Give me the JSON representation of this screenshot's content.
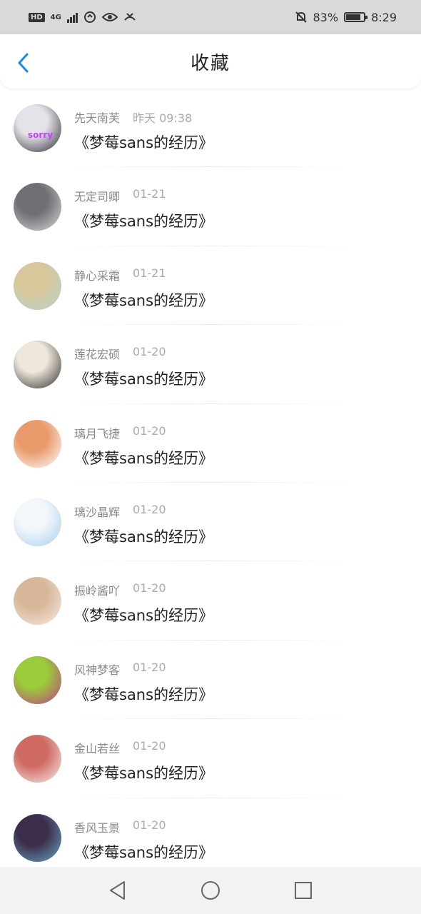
{
  "status_bar": {
    "left_text": "HD",
    "network": "4G",
    "battery": "83%",
    "battery_level": 0.83,
    "time": "8:29"
  },
  "header": {
    "title": "收藏",
    "accent_color": "#1e88e5"
  },
  "favorites": [
    {
      "user": "先天南芙",
      "time": "昨天 09:38",
      "title": "《梦莓sans的经历》",
      "avatar_colors": [
        "#2b2b33",
        "#e6e2e9"
      ],
      "avatar_text": "sorry"
    },
    {
      "user": "无定司卿",
      "time": "01-21",
      "title": "《梦莓sans的经历》",
      "avatar_colors": [
        "#d9d9d9",
        "#6f6f74"
      ]
    },
    {
      "user": "静心采霜",
      "time": "01-21",
      "title": "《梦莓sans的经历》",
      "avatar_colors": [
        "#b4d3cf",
        "#d8c79b"
      ]
    },
    {
      "user": "莲花宏硕",
      "time": "01-20",
      "title": "《梦莓sans的经历》",
      "avatar_colors": [
        "#2e2e2e",
        "#efe6dc"
      ]
    },
    {
      "user": "璃月飞捷",
      "time": "01-20",
      "title": "《梦莓sans的经历》",
      "avatar_colors": [
        "#ffffff",
        "#e89a6a"
      ]
    },
    {
      "user": "璃沙晶辉",
      "time": "01-20",
      "title": "《梦莓sans的经历》",
      "avatar_colors": [
        "#a8cdec",
        "#f3f7fb"
      ]
    },
    {
      "user": "振岭酱吖",
      "time": "01-20",
      "title": "《梦莓sans的经历》",
      "avatar_colors": [
        "#f6eee4",
        "#d7b79a"
      ]
    },
    {
      "user": "风神梦客",
      "time": "01-20",
      "title": "《梦莓sans的经历》",
      "avatar_colors": [
        "#c2388a",
        "#9bcc3a"
      ]
    },
    {
      "user": "金山若丝",
      "time": "01-20",
      "title": "《梦莓sans的经历》",
      "avatar_colors": [
        "#f7f1ec",
        "#cf6a63"
      ]
    },
    {
      "user": "香风玉景",
      "time": "01-20",
      "title": "《梦莓sans的经历》",
      "avatar_colors": [
        "#6aa7c9",
        "#3b2e4a"
      ]
    }
  ],
  "nav_bar": {
    "icons": [
      "back-triangle-icon",
      "home-circle-icon",
      "recents-square-icon"
    ]
  }
}
